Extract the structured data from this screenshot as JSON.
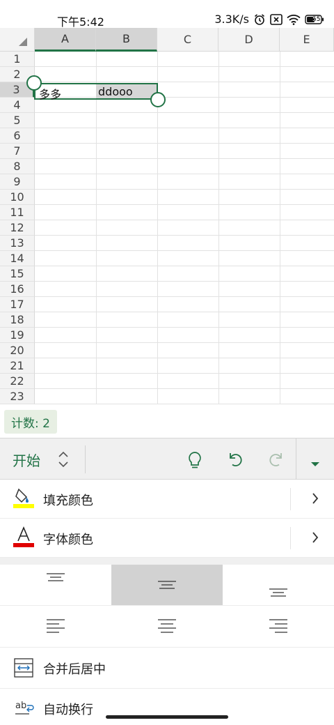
{
  "status_bar": {
    "time": "下午5:42",
    "network_speed": "3.3K/s",
    "battery_level": "55",
    "icons": [
      "alarm-icon",
      "sim-disabled-icon",
      "wifi-icon",
      "battery-icon"
    ]
  },
  "sheet": {
    "columns": [
      "A",
      "B",
      "C",
      "D",
      "E"
    ],
    "selected_columns": [
      "A",
      "B"
    ],
    "rows": [
      "1",
      "2",
      "3",
      "4",
      "5",
      "6",
      "7",
      "8",
      "9",
      "10",
      "11",
      "12",
      "13",
      "14",
      "15",
      "16",
      "17",
      "18",
      "19",
      "20",
      "21",
      "22",
      "23"
    ],
    "selected_row": "3",
    "cells": {
      "A3": "多多",
      "B3": "ddooo"
    }
  },
  "selection_summary": {
    "count_label": "计数: 2"
  },
  "toolbar": {
    "tab_label": "开始",
    "icons": [
      "chevron-updown-icon",
      "lightbulb-icon",
      "undo-icon",
      "redo-icon",
      "dropdown-caret-icon"
    ],
    "accent_color": "#217346"
  },
  "panel": {
    "fill_color_label": "填充颜色",
    "fill_color_swatch": "#ffff00",
    "font_color_label": "字体颜色",
    "font_color_swatch": "#e00000",
    "merge_center_label": "合并后居中",
    "wrap_text_label": "自动换行",
    "vertical_alignment": [
      "top",
      "middle",
      "bottom"
    ],
    "vertical_alignment_selected": "middle",
    "horizontal_alignment": [
      "left",
      "center",
      "right"
    ]
  }
}
